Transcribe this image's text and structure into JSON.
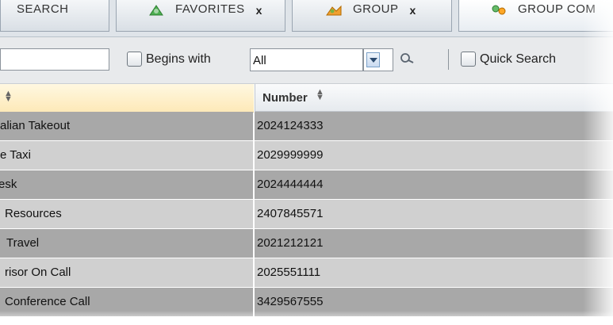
{
  "tabs": [
    {
      "id": "search",
      "label": "SEARCH",
      "close": ""
    },
    {
      "id": "favorites",
      "label": "FAVORITES",
      "close": "x",
      "icon": "favorites-icon"
    },
    {
      "id": "group",
      "label": "GROUP",
      "close": "x",
      "icon": "group-icon"
    },
    {
      "id": "group_common",
      "label": "GROUP COM",
      "close": "",
      "icon": "group-common-icon"
    }
  ],
  "toolbar": {
    "search_value": "",
    "begins_with_label": "Begins with",
    "begins_with_checked": false,
    "filter_value": "All",
    "quick_search_label": "Quick Search",
    "quick_search_checked": false
  },
  "grid": {
    "columns": [
      "",
      "Number"
    ],
    "rows": [
      {
        "name": "alian Takeout",
        "number": "2024124333"
      },
      {
        "name": "e Taxi",
        "number": "2029999999"
      },
      {
        "name": "esk",
        "number": "2024444444"
      },
      {
        "name": " Resources",
        "number": "2407845571"
      },
      {
        "name": "Travel",
        "number": "2021212121"
      },
      {
        "name": "risor On Call",
        "number": "2025551111"
      },
      {
        "name": " Conference Call",
        "number": "3429567555"
      }
    ]
  },
  "colors": {
    "row_dark": "#a8a8a8",
    "row_light": "#d0d0d0",
    "header_name_bg": "#fde9b8"
  }
}
